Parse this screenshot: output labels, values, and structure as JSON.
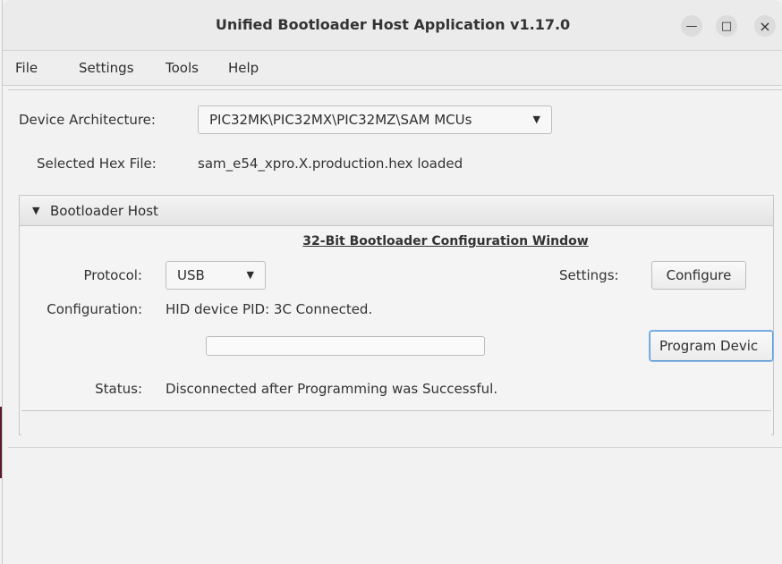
{
  "window": {
    "title": "Unified Bootloader Host Application v1.17.0",
    "minimize_glyph": "—",
    "maximize_glyph": "□",
    "close_glyph": "×"
  },
  "menu": {
    "items": [
      "File",
      "Settings",
      "Tools",
      "Help"
    ]
  },
  "device": {
    "architecture_label": "Device Architecture:",
    "architecture_value": "PIC32MK\\PIC32MX\\PIC32MZ\\SAM MCUs",
    "hex_label": "Selected Hex File:",
    "hex_value": "sam_e54_xpro.X.production.hex loaded"
  },
  "bootloader": {
    "section_label": "Bootloader Host",
    "expanded_glyph": "▼",
    "config_window_title": "32-Bit Bootloader Configuration Window",
    "protocol_label": "Protocol:",
    "protocol_value": "USB",
    "settings_label": "Settings:",
    "configure_button": "Configure",
    "configuration_label": "Configuration:",
    "configuration_value": "HID device PID: 3C Connected.",
    "program_button": "Program Devic",
    "progress": 0,
    "status_label": "Status:",
    "status_value": "Disconnected after Programming was Successful."
  },
  "colors": {
    "accent": "#4a90d9",
    "focus_border": "#5b9bd5"
  }
}
